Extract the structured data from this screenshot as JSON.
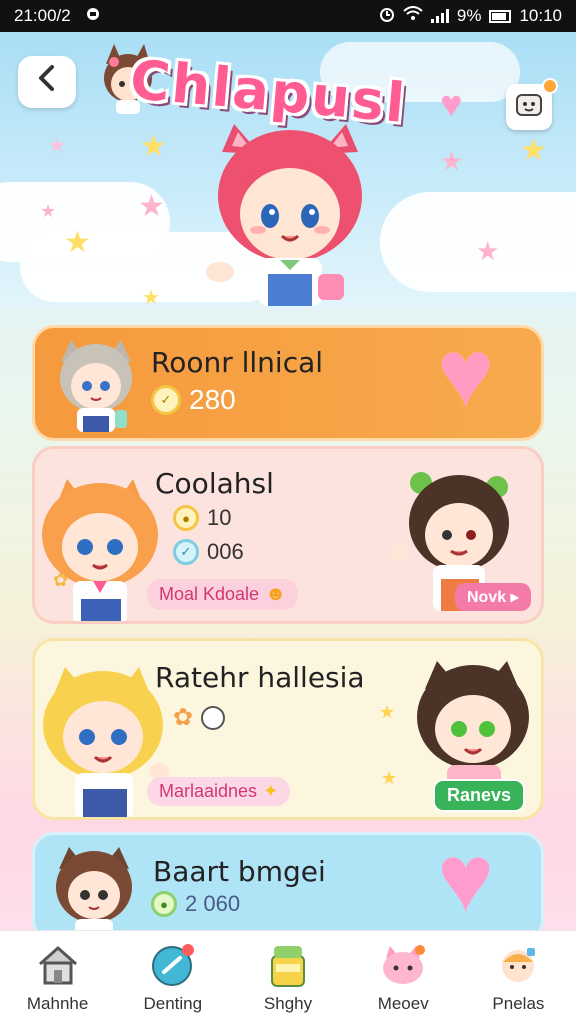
{
  "status_bar": {
    "time_left": "21:00/2",
    "battery": "9%",
    "clock": "10:10"
  },
  "header": {
    "title": "Chlapusl",
    "back_icon": "chevron-left-icon",
    "settings_icon": "notification-mascot-icon"
  },
  "cards": [
    {
      "title": "Roonr llnical",
      "coins": "280",
      "icon": "heart-icon",
      "color": "#f59a3d"
    },
    {
      "title": "Coolahsl",
      "stat1": "10",
      "stat2": "006",
      "tag": "Moal Kdoale",
      "button": "Novk",
      "color": "#fde3de"
    },
    {
      "title": "Ratehr hallesia",
      "tag": "Marlaaidnes",
      "button": "Ranevs",
      "color": "#fdf6df"
    },
    {
      "title": "Baart bmgei",
      "coins": "2 060",
      "icon": "heart-icon",
      "color": "#aee4f6"
    }
  ],
  "bottom_nav": [
    {
      "label": "Mahnhe",
      "icon": "home-icon"
    },
    {
      "label": "Denting",
      "icon": "search-badge-icon"
    },
    {
      "label": "Shghy",
      "icon": "shop-icon"
    },
    {
      "label": "Meoev",
      "icon": "cat-icon"
    },
    {
      "label": "Pnelas",
      "icon": "profile-icon"
    }
  ]
}
